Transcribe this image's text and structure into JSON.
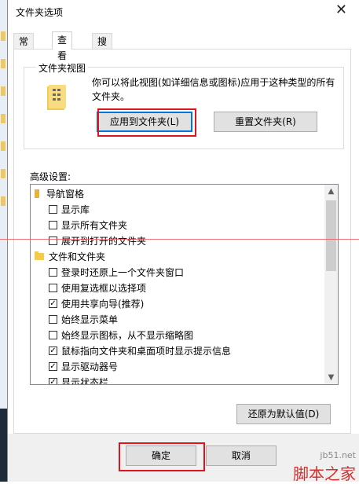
{
  "window": {
    "title": "文件夹选项"
  },
  "tabs": [
    {
      "label": "常规",
      "active": false
    },
    {
      "label": "查看",
      "active": true
    },
    {
      "label": "搜索",
      "active": false
    }
  ],
  "folder_view": {
    "group_label": "文件夹视图",
    "description": "你可以将此视图(如详细信息或图标)应用于这种类型的所有文件夹。",
    "apply_button": "应用到文件夹(L)",
    "reset_button": "重置文件夹(R)"
  },
  "advanced": {
    "label": "高级设置:",
    "items": [
      {
        "label": "导航窗格",
        "kind": "category"
      },
      {
        "label": "显示库",
        "checked": false
      },
      {
        "label": "显示所有文件夹",
        "checked": false
      },
      {
        "label": "展开到打开的文件夹",
        "checked": false
      },
      {
        "label": "文件和文件夹",
        "kind": "category"
      },
      {
        "label": "登录时还原上一个文件夹窗口",
        "checked": false
      },
      {
        "label": "使用复选框以选择项",
        "checked": false
      },
      {
        "label": "使用共享向导(推荐)",
        "checked": true
      },
      {
        "label": "始终显示菜单",
        "checked": false
      },
      {
        "label": "始终显示图标，从不显示缩略图",
        "checked": false
      },
      {
        "label": "鼠标指向文件夹和桌面项时显示提示信息",
        "checked": true
      },
      {
        "label": "显示驱动器号",
        "checked": true
      },
      {
        "label": "显示状态栏",
        "checked": true
      }
    ]
  },
  "restore_button": "还原为默认值(D)",
  "footer": {
    "ok_button": "确定",
    "cancel_button": "取消"
  },
  "watermark": {
    "url": "jb51.net",
    "name": "脚本之家"
  },
  "colors": {
    "highlight": "#e0141e",
    "accent": "#0078d7",
    "folder": "#f3c94e"
  }
}
